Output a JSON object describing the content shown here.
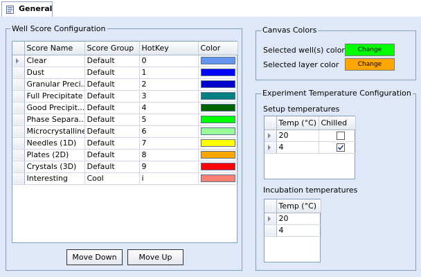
{
  "tab": {
    "label": "General"
  },
  "well_score": {
    "title": "Well Score Configuration",
    "columns": [
      "Score Name",
      "Score Group",
      "HotKey",
      "Color"
    ],
    "rows": [
      {
        "name": "Clear",
        "group": "Default",
        "hotkey": "0",
        "color": "#6495ed"
      },
      {
        "name": "Dust",
        "group": "Default",
        "hotkey": "1",
        "color": "#0000ff"
      },
      {
        "name": "Granular Preci...",
        "group": "Default",
        "hotkey": "2",
        "color": "#0000cd"
      },
      {
        "name": "Full Precipitate",
        "group": "Default",
        "hotkey": "3",
        "color": "#008080"
      },
      {
        "name": "Good Precipit...",
        "group": "Default",
        "hotkey": "4",
        "color": "#006400"
      },
      {
        "name": "Phase  Separa...",
        "group": "Default",
        "hotkey": "5",
        "color": "#00ff00"
      },
      {
        "name": "Microcrystalline",
        "group": "Default",
        "hotkey": "6",
        "color": "#98fb98"
      },
      {
        "name": "Needles (1D)",
        "group": "Default",
        "hotkey": "7",
        "color": "#ffff00"
      },
      {
        "name": "Plates (2D)",
        "group": "Default",
        "hotkey": "8",
        "color": "#ffa500"
      },
      {
        "name": "Crystals (3D)",
        "group": "Default",
        "hotkey": "9",
        "color": "#ff0000"
      },
      {
        "name": "Interesting",
        "group": "Cool",
        "hotkey": "i",
        "color": "#fa8072"
      }
    ],
    "move_down_label": "Move Down",
    "move_up_label": "Move Up"
  },
  "canvas_colors": {
    "title": "Canvas Colors",
    "selected_wells_label": "Selected well(s) color",
    "selected_wells_color": "#00ff00",
    "selected_layer_label": "Selected layer color",
    "selected_layer_color": "#ffa500",
    "change_label": "Change"
  },
  "experiment_temp": {
    "title": "Experiment Temperature Configuration",
    "setup_label": "Setup temperatures",
    "setup_columns": [
      "Temp (°C)",
      "Chilled"
    ],
    "setup_rows": [
      {
        "temp": "20",
        "chilled": false
      },
      {
        "temp": "4",
        "chilled": true
      }
    ],
    "incubation_label": "Incubation temperatures",
    "incubation_columns": [
      "Temp (°C)"
    ],
    "incubation_rows": [
      {
        "temp": "20"
      },
      {
        "temp": "4"
      }
    ]
  }
}
